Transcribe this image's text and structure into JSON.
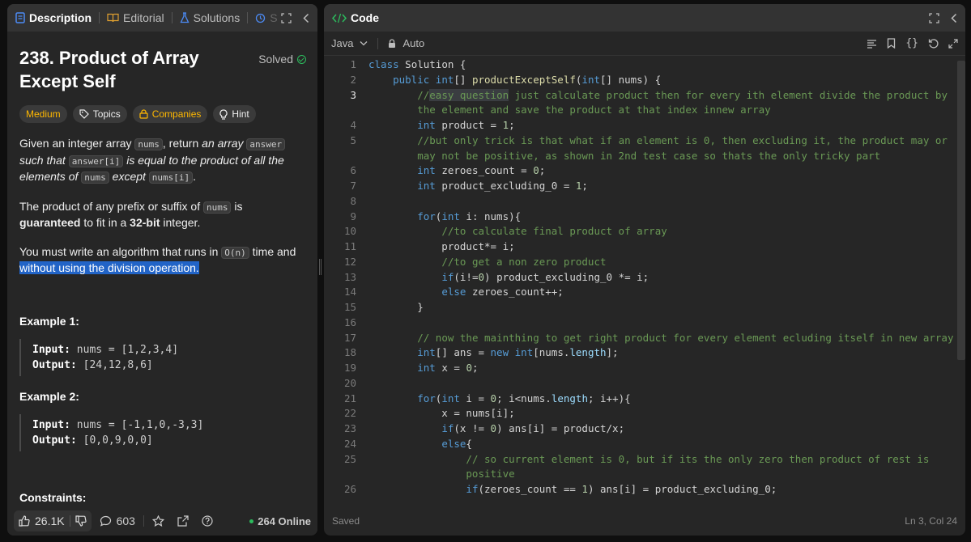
{
  "left_tabs": {
    "description": "Description",
    "editorial": "Editorial",
    "solutions": "Solutions",
    "submissions_abbrev": "S"
  },
  "problem": {
    "title": "238. Product of Array Except Self",
    "status": "Solved",
    "chips": {
      "difficulty": "Medium",
      "topics": "Topics",
      "companies": "Companies",
      "hint": "Hint"
    },
    "para1": {
      "a": "Given an integer array ",
      "nums": "nums",
      "b": ", return ",
      "c": "an array ",
      "answer": "answer",
      "d": " such that ",
      "answer_i": "answer[i]",
      "e": " is equal to the product of all the elements of ",
      "nums2": "nums",
      "f": " except ",
      "nums_i": "nums[i]",
      "g": "."
    },
    "para2": {
      "a": "The product of any prefix or suffix of ",
      "nums": "nums",
      "b": " is ",
      "guaranteed": "guaranteed",
      "c": " to fit in a ",
      "bits": "32-bit",
      "d": " integer."
    },
    "para3": {
      "a": "You must write an algorithm that runs in ",
      "complexity": "O(n)",
      "b": " time and ",
      "highlight": "without using the division operation."
    },
    "example1": {
      "heading": "Example 1:",
      "input_label": "Input:",
      "input": " nums = [1,2,3,4]",
      "output_label": "Output:",
      "output": " [24,12,8,6]"
    },
    "example2": {
      "heading": "Example 2:",
      "input_label": "Input:",
      "input": " nums = [-1,1,0,-3,3]",
      "output_label": "Output:",
      "output": " [0,0,9,0,0]"
    },
    "constraints": "Constraints:"
  },
  "left_footer": {
    "likes": "26.1K",
    "comments": "603",
    "online": "264 Online"
  },
  "code_panel": {
    "title": "Code",
    "language": "Java",
    "mode": "Auto",
    "status": "Saved",
    "cursor": "Ln 3, Col 24"
  },
  "code_lines": [
    {
      "n": "1",
      "t": "class Solution {"
    },
    {
      "n": "2",
      "t": "    public int[] productExceptSelf(int[] nums) {"
    },
    {
      "n": "3",
      "t": "        //easy question just calculate product then for every ith element divide the product by",
      "t2": "        the element and save the product at that index innew array"
    },
    {
      "n": "4",
      "t": "        int product = 1;"
    },
    {
      "n": "5",
      "t": "        //but only trick is that what if an element is 0, then excluding it, the product may or",
      "t2": "        may not be positive, as shown in 2nd test case so thats the only tricky part"
    },
    {
      "n": "6",
      "t": "        int zeroes_count = 0;"
    },
    {
      "n": "7",
      "t": "        int product_excluding_0 = 1;"
    },
    {
      "n": "8",
      "t": ""
    },
    {
      "n": "9",
      "t": "        for(int i: nums){"
    },
    {
      "n": "10",
      "t": "            //to calculate final product of array"
    },
    {
      "n": "11",
      "t": "            product*= i;"
    },
    {
      "n": "12",
      "t": "            //to get a non zero product"
    },
    {
      "n": "13",
      "t": "            if(i!=0) product_excluding_0 *= i;"
    },
    {
      "n": "14",
      "t": "            else zeroes_count++;"
    },
    {
      "n": "15",
      "t": "        }"
    },
    {
      "n": "16",
      "t": ""
    },
    {
      "n": "17",
      "t": "        // now the mainthing to get right product for every element ecluding itself in new array"
    },
    {
      "n": "18",
      "t": "        int[] ans = new int[nums.length];"
    },
    {
      "n": "19",
      "t": "        int x = 0;"
    },
    {
      "n": "20",
      "t": ""
    },
    {
      "n": "21",
      "t": "        for(int i = 0; i<nums.length; i++){"
    },
    {
      "n": "22",
      "t": "            x = nums[i];"
    },
    {
      "n": "23",
      "t": "            if(x != 0) ans[i] = product/x;"
    },
    {
      "n": "24",
      "t": "            else{"
    },
    {
      "n": "25",
      "t": "                // so current element is 0, but if its the only zero then product of rest is",
      "t2": "                positive"
    },
    {
      "n": "26",
      "t": "                if(zeroes_count == 1) ans[i] = product_excluding_0;"
    }
  ]
}
